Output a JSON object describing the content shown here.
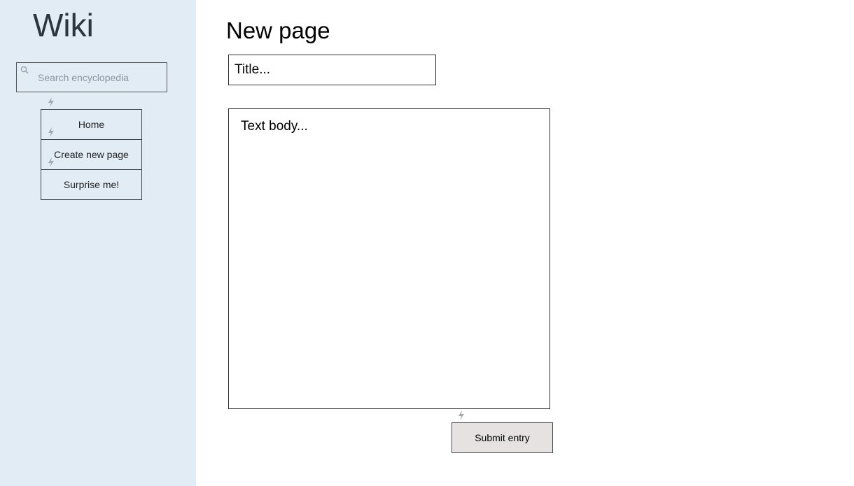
{
  "sidebar": {
    "brand": "Wiki",
    "search": {
      "placeholder": "Search encyclopedia",
      "icon": "search-icon"
    },
    "items": [
      {
        "label": "Home",
        "icon": "bolt-icon"
      },
      {
        "label": "Create new page",
        "icon": "bolt-icon"
      },
      {
        "label": "Surprise me!",
        "icon": "bolt-icon"
      }
    ],
    "background": "#e2ecf5"
  },
  "main": {
    "heading": "New page",
    "title_field": {
      "placeholder": "Title...",
      "value": ""
    },
    "body_field": {
      "placeholder": "Text body...",
      "value": ""
    },
    "submit_label": "Submit entry",
    "submit_background": "#e6e2e2"
  }
}
